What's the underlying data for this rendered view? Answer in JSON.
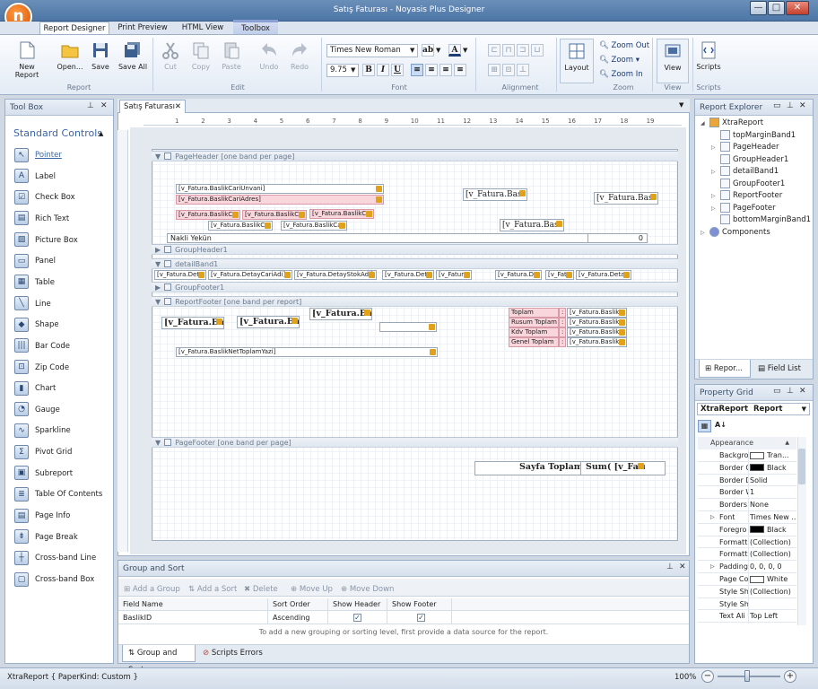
{
  "window": {
    "title": "Satış Faturası - Noyasis Plus Designer",
    "logo": "n"
  },
  "ribbon": {
    "tabs": [
      "Report Designer",
      "Print Preview",
      "HTML View",
      "Toolbox"
    ],
    "groups": {
      "report": "Report",
      "edit": "Edit",
      "font": "Font",
      "alignment": "Alignment",
      "zoom": "Zoom",
      "view": "View",
      "scripts": "Scripts"
    },
    "buttons": {
      "new_report": "New Report",
      "open": "Open...",
      "save": "Save",
      "save_all": "Save All",
      "cut": "Cut",
      "copy": "Copy",
      "paste": "Paste",
      "undo": "Undo",
      "redo": "Redo",
      "layout": "Layout",
      "zoom_out": "Zoom Out",
      "zoom": "Zoom",
      "zoom_in": "Zoom In",
      "view": "View",
      "scripts": "Scripts"
    },
    "font_name": "Times New Roman",
    "font_size": "9.75"
  },
  "toolbox": {
    "title": "Tool Box",
    "section": "Standard Controls",
    "items": [
      "Pointer",
      "Label",
      "Check Box",
      "Rich Text",
      "Picture Box",
      "Panel",
      "Table",
      "Line",
      "Shape",
      "Bar Code",
      "Zip Code",
      "Chart",
      "Gauge",
      "Sparkline",
      "Pivot Grid",
      "Subreport",
      "Table Of Contents",
      "Page Info",
      "Page Break",
      "Cross-band Line",
      "Cross-band Box"
    ]
  },
  "document": {
    "tab": "Satış Faturası",
    "ruler_top": [
      "1",
      "2",
      "3",
      "4",
      "5",
      "6",
      "7",
      "8",
      "9",
      "10",
      "11",
      "12",
      "13",
      "14",
      "15",
      "16",
      "17",
      "18",
      "19"
    ],
    "ruler_left_header": [
      "1",
      "2",
      "3"
    ],
    "ruler_left_footer": [
      "1",
      "2",
      "3",
      "4",
      "5"
    ],
    "bands": {
      "page_header": "PageHeader [one band per page]",
      "group_header": "GroupHeader1",
      "detail": "detailBand1",
      "group_footer": "GroupFooter1",
      "report_footer": "ReportFooter [one band per report]",
      "page_footer": "PageFooter [one band per page]"
    },
    "fields": {
      "cari_unvani": "[v_Fatura.BaslikCariUnvani]",
      "cari_adres": "[v_Fatura.BaslikCariAdres]",
      "h_right1": "[v_Fatura.Basl",
      "h_right2": "[v_Fatura.Basl",
      "h_right3": "[v_Fatura.Basl",
      "h_c1": "[v_Fatura.BaslikC",
      "h_c2": "[v_Fatura.BaslikC",
      "h_c3": "[v_Fatura.BaslikC",
      "h_c4": "[v_Fatura.BaslikC",
      "h_c5": "[v_Fatura.BaslikCa",
      "nakli_yekun": "Nakli Yekün",
      "nakli_value": "0",
      "d1": "[v_Fatura.Deta",
      "d2": "[v_Fatura.DetayCariAdi]",
      "d3": "[v_Fatura.DetayStokAdi]",
      "d4": "[v_Fatura.Deta",
      "d5": "[v_Fatur",
      "d6": "[v_Fatura.D",
      "d7": "[v_Fat",
      "d8": "[v_Fatura.Deta",
      "rf1": "[v_Fatura.Ba",
      "rf2": "[v_Fatura.Ba",
      "rf3": "[v_Fatura.Ba",
      "net_toplam": "[v_Fatura.BaslikNetToplamYazi]",
      "toplam": "Toplam",
      "rusum_toplam": "Rusum Toplam",
      "kdv_toplam": "Kdv Toplam",
      "genel_toplam": "Genel Toplam",
      "colon": ":",
      "rv1": "[v_Fatura.BaslikT",
      "rv2": "[v_Fatura.BaslikR",
      "rv3": "[v_Fatura.BaslikK",
      "rv4": "[v_Fatura.BaslikN",
      "sayfa_toplami": "Sayfa Toplamı",
      "sum_field": "Sum( [v_Fatu"
    }
  },
  "explorer": {
    "title": "Report Explorer",
    "nodes": [
      "XtraReport",
      "topMarginBand1",
      "PageHeader",
      "GroupHeader1",
      "detailBand1",
      "GroupFooter1",
      "ReportFooter",
      "PageFooter",
      "bottomMarginBand1",
      "Components"
    ],
    "tabs": [
      "Repor...",
      "Field List"
    ]
  },
  "property_grid": {
    "title": "Property Grid",
    "selected_object": "XtraReport",
    "selected_type": "Report",
    "category": "Appearance",
    "rows": [
      {
        "name": "Backgro",
        "value": "Tran..."
      },
      {
        "name": "Border C",
        "value": "Black"
      },
      {
        "name": "Border D",
        "value": "Solid"
      },
      {
        "name": "Border W",
        "value": "1"
      },
      {
        "name": "Borders",
        "value": "None"
      },
      {
        "name": "Font",
        "value": "Times New ..."
      },
      {
        "name": "Foregro",
        "value": "Black"
      },
      {
        "name": "Formatt",
        "value": "(Collection)"
      },
      {
        "name": "Formatt",
        "value": "(Collection)"
      },
      {
        "name": "Padding",
        "value": "0, 0, 0, 0"
      },
      {
        "name": "Page Co",
        "value": "White"
      },
      {
        "name": "Style Sh",
        "value": "(Collection)"
      },
      {
        "name": "Style Sh",
        "value": ""
      },
      {
        "name": "Text Ali",
        "value": "Top Left"
      }
    ]
  },
  "group_sort": {
    "title": "Group and Sort",
    "buttons": [
      "Add a Group",
      "Add a Sort",
      "Delete",
      "Move Up",
      "Move Down"
    ],
    "columns": [
      "Field Name",
      "Sort Order",
      "Show Header",
      "Show Footer"
    ],
    "rows": [
      {
        "field": "BaslikID",
        "order": "Ascending",
        "show_header": true,
        "show_footer": true
      }
    ],
    "hint": "To add a new grouping or sorting level, first provide a data source for the report.",
    "tabs": [
      "Group and Sort",
      "Scripts Errors"
    ]
  },
  "status": {
    "left": "XtraReport { PaperKind: Custom }",
    "zoom": "100%"
  },
  "colors": {
    "accent": "#4d76a6",
    "band_pink": "#f9d5dc",
    "field_tag": "#e0a21a"
  }
}
